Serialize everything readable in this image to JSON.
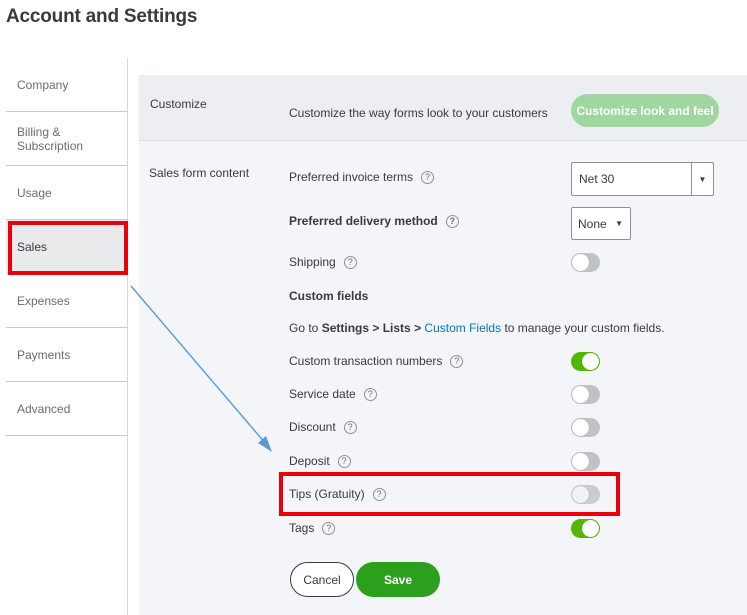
{
  "header": {
    "title": "Account and Settings"
  },
  "sidebar": {
    "items": [
      {
        "label": "Company"
      },
      {
        "label": "Billing & Subscription"
      },
      {
        "label": "Usage"
      },
      {
        "label": "Sales"
      },
      {
        "label": "Expenses"
      },
      {
        "label": "Payments"
      },
      {
        "label": "Advanced"
      }
    ],
    "active": "Sales"
  },
  "customize": {
    "section_label": "Customize",
    "description": "Customize the way forms look to your customers",
    "button_label": "Customize look and feel"
  },
  "sales_form": {
    "section_label": "Sales form content",
    "invoice_terms": {
      "label": "Preferred invoice terms",
      "value": "Net 30"
    },
    "delivery_method": {
      "label": "Preferred delivery method",
      "value": "None"
    },
    "shipping": {
      "label": "Shipping",
      "on": false
    },
    "custom_fields_heading": "Custom fields",
    "manage_text": {
      "prefix": "Go to ",
      "settings": "Settings",
      "sep": " > ",
      "lists": "Lists",
      "sep2": " > ",
      "link": "Custom Fields",
      "suffix": " to manage your custom fields."
    },
    "toggles": [
      {
        "label": "Custom transaction numbers",
        "on": true
      },
      {
        "label": "Service date",
        "on": false
      },
      {
        "label": "Discount",
        "on": false
      },
      {
        "label": "Deposit",
        "on": false
      },
      {
        "label": "Tips (Gratuity)",
        "on": false
      },
      {
        "label": "Tags",
        "on": true
      }
    ]
  },
  "actions": {
    "cancel_label": "Cancel",
    "save_label": "Save"
  },
  "help_glyph": "?",
  "caret_glyph": "▼",
  "colors": {
    "accent_green": "#2ca01c",
    "toggle_on": "#53b700",
    "link_blue": "#0077c5",
    "highlight_red": "#e8000b",
    "arrow_blue": "#5b9bd5"
  }
}
